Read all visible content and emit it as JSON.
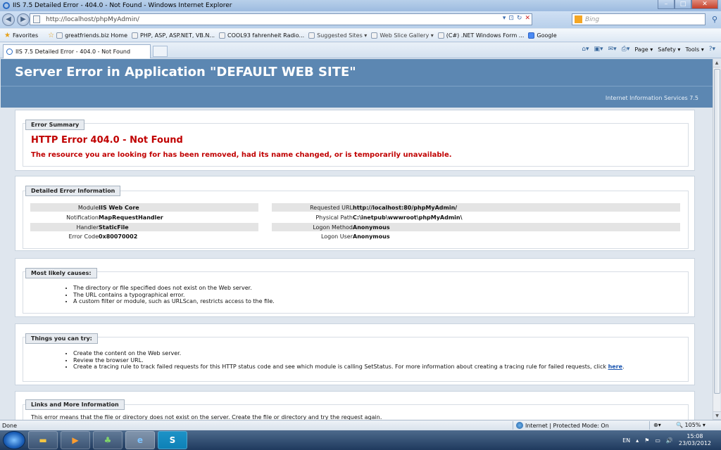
{
  "window": {
    "title": "IIS 7.5 Detailed Error - 404.0 - Not Found - Windows Internet Explorer",
    "minimize": "–",
    "maximize": "□",
    "close": "✕"
  },
  "addressbar": {
    "url": "http://localhost/phpMyAdmin/",
    "search_placeholder": "Bing"
  },
  "favorites": [
    {
      "label": "Favorites",
      "icon": "star-icon"
    },
    {
      "label": "greatfriends.biz Home",
      "icon": "site-icon"
    },
    {
      "label": "PHP, ASP, ASP.NET, VB.N...",
      "icon": "page-icon"
    },
    {
      "label": "COOL93 fahrenheit  Radio...",
      "icon": "page-icon"
    },
    {
      "label": "Suggested Sites ▾",
      "icon": "page-icon"
    },
    {
      "label": "Web Slice Gallery ▾",
      "icon": "page-icon"
    },
    {
      "label": "(C#) .NET Windows Form ...",
      "icon": "page-icon"
    },
    {
      "label": "Google",
      "icon": "google-icon"
    }
  ],
  "tabs": [
    {
      "label": "IIS 7.5 Detailed Error - 404.0 - Not Found"
    }
  ],
  "commandbar": {
    "page": "Page ▾",
    "safety": "Safety ▾",
    "tools": "Tools ▾"
  },
  "page": {
    "header": "Server Error in Application \"DEFAULT WEB SITE\"",
    "server": "Internet Information Services 7.5",
    "summary": {
      "legend": "Error Summary",
      "title": "HTTP Error 404.0 - Not Found",
      "message": "The resource you are looking for has been removed, had its name changed, or is temporarily unavailable."
    },
    "details": {
      "legend": "Detailed Error Information",
      "left": [
        {
          "key": "Module",
          "value": "IIS Web Core"
        },
        {
          "key": "Notification",
          "value": "MapRequestHandler"
        },
        {
          "key": "Handler",
          "value": "StaticFile"
        },
        {
          "key": "Error Code",
          "value": "0x80070002"
        }
      ],
      "right": [
        {
          "key": "Requested URL",
          "value": "http://localhost:80/phpMyAdmin/"
        },
        {
          "key": "Physical Path",
          "value": "C:\\inetpub\\wwwroot\\phpMyAdmin\\"
        },
        {
          "key": "Logon Method",
          "value": "Anonymous"
        },
        {
          "key": "Logon User",
          "value": "Anonymous"
        }
      ]
    },
    "causes": {
      "legend": "Most likely causes:",
      "items": [
        "The directory or file specified does not exist on the Web server.",
        "The URL contains a typographical error.",
        "A custom filter or module, such as URLScan, restricts access to the file."
      ]
    },
    "try": {
      "legend": "Things you can try:",
      "items": [
        "Create the content on the Web server.",
        "Review the browser URL.",
        "Create a tracing rule to track failed requests for this HTTP status code and see which module is calling SetStatus. For more information about creating a tracing rule for failed requests, click "
      ],
      "link": "here",
      "after_link": "."
    },
    "links": {
      "legend": "Links and More Information",
      "text": "This error means that the file or directory does not exist on the server. Create the file or directory and try the request again."
    }
  },
  "statusbar": {
    "left": "Done",
    "zone": "Internet | Protected Mode: On",
    "zoom": "105%"
  },
  "taskbar": {
    "lang": "EN",
    "time": "15:08",
    "date": "23/03/2012",
    "skype_label": "S"
  }
}
